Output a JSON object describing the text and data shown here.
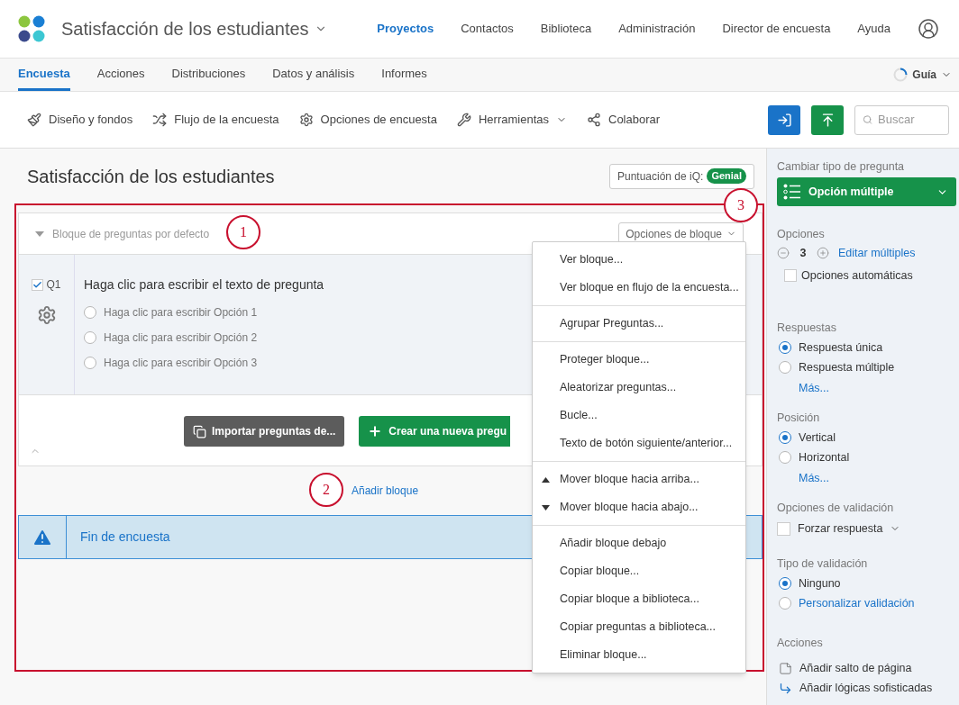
{
  "header": {
    "project_title": "Satisfacción de los estudiantes",
    "nav": [
      {
        "label": "Proyectos",
        "selected": true
      },
      {
        "label": "Contactos",
        "selected": false
      },
      {
        "label": "Biblioteca",
        "selected": false
      },
      {
        "label": "Administración",
        "selected": false
      },
      {
        "label": "Director de encuesta",
        "selected": false
      },
      {
        "label": "Ayuda",
        "selected": false
      }
    ]
  },
  "tabs": [
    {
      "label": "Encuesta",
      "selected": true
    },
    {
      "label": "Acciones",
      "selected": false
    },
    {
      "label": "Distribuciones",
      "selected": false
    },
    {
      "label": "Datos y análisis",
      "selected": false
    },
    {
      "label": "Informes",
      "selected": false
    }
  ],
  "guide": "Guía",
  "toolbar": [
    {
      "label": "Diseño y fondos",
      "kind": "brush"
    },
    {
      "label": "Flujo de la encuesta",
      "kind": "flow"
    },
    {
      "label": "Opciones de encuesta",
      "kind": "gear"
    },
    {
      "label": "Herramientas",
      "kind": "tools"
    },
    {
      "label": "Colaborar",
      "kind": "share"
    }
  ],
  "search": {
    "placeholder": "Buscar"
  },
  "survey_title": "Satisfacción de los estudiantes",
  "iq_score": {
    "label": "Puntuación de iQ:",
    "badge": "Genial"
  },
  "block": {
    "title": "Bloque de preguntas por defecto",
    "options_button": "Opciones de bloque",
    "question": {
      "number": "Q1",
      "checked": true,
      "text": "Haga clic para escribir el texto de pregunta",
      "choices": [
        {
          "label": "Haga clic para escribir Opción 1",
          "selected": false
        },
        {
          "label": "Haga clic para escribir Opción 2",
          "selected": false
        },
        {
          "label": "Haga clic para escribir Opción 3",
          "selected": false
        }
      ]
    },
    "import_button": "Importar preguntas de...",
    "create_button": "Crear una nueva pregu"
  },
  "add_block": "Añadir bloque",
  "end_of_survey": "Fin de encuesta",
  "block_menu": [
    [
      {
        "label": "Ver bloque...",
        "kind": "plain"
      },
      {
        "label": "Ver bloque en flujo de la encuesta...",
        "kind": "plain"
      }
    ],
    [
      {
        "label": "Agrupar Preguntas...",
        "kind": "plain"
      }
    ],
    [
      {
        "label": "Proteger bloque...",
        "kind": "plain"
      },
      {
        "label": "Aleatorizar preguntas...",
        "kind": "plain"
      },
      {
        "label": "Bucle...",
        "kind": "plain"
      },
      {
        "label": "Texto de botón siguiente/anterior...",
        "kind": "plain"
      }
    ],
    [
      {
        "label": "Mover bloque hacia arriba...",
        "kind": "up"
      },
      {
        "label": "Mover bloque hacia abajo...",
        "kind": "down"
      }
    ],
    [
      {
        "label": "Añadir bloque debajo",
        "kind": "plain"
      },
      {
        "label": "Copiar bloque...",
        "kind": "plain"
      },
      {
        "label": "Copiar bloque a biblioteca...",
        "kind": "plain"
      },
      {
        "label": "Copiar preguntas a biblioteca...",
        "kind": "plain"
      },
      {
        "label": "Eliminar bloque...",
        "kind": "plain"
      }
    ]
  ],
  "annotations": [
    "1",
    "2",
    "3"
  ],
  "sidebar": {
    "change_type_label": "Cambiar tipo de pregunta",
    "question_type": "Opción múltiple",
    "choices_label": "Opciones",
    "choice_count": "3",
    "edit_multiple": "Editar múltiples",
    "auto_choices": {
      "label": "Opciones automáticas",
      "checked": false
    },
    "answers_label": "Respuestas",
    "answers": [
      {
        "label": "Respuesta única",
        "selected": true,
        "kind": "text"
      },
      {
        "label": "Respuesta múltiple",
        "selected": false,
        "kind": "text"
      }
    ],
    "answers_more": "Más...",
    "position_label": "Posición",
    "position": [
      {
        "label": "Vertical",
        "selected": true,
        "kind": "text"
      },
      {
        "label": "Horizontal",
        "selected": false,
        "kind": "text"
      }
    ],
    "position_more": "Más...",
    "validation_options_label": "Opciones de validación",
    "force_response": {
      "label": "Forzar respuesta",
      "checked": false
    },
    "validation_type_label": "Tipo de validación",
    "validation_type": [
      {
        "label": "Ninguno",
        "selected": true,
        "kind": "text"
      },
      {
        "label": "Personalizar validación",
        "selected": false,
        "kind": "link"
      }
    ],
    "actions_label": "Acciones",
    "actions": [
      {
        "label": "Añadir salto de página",
        "kind": "page_break"
      },
      {
        "label": "Añadir lógicas sofisticadas",
        "kind": "logic"
      }
    ]
  }
}
